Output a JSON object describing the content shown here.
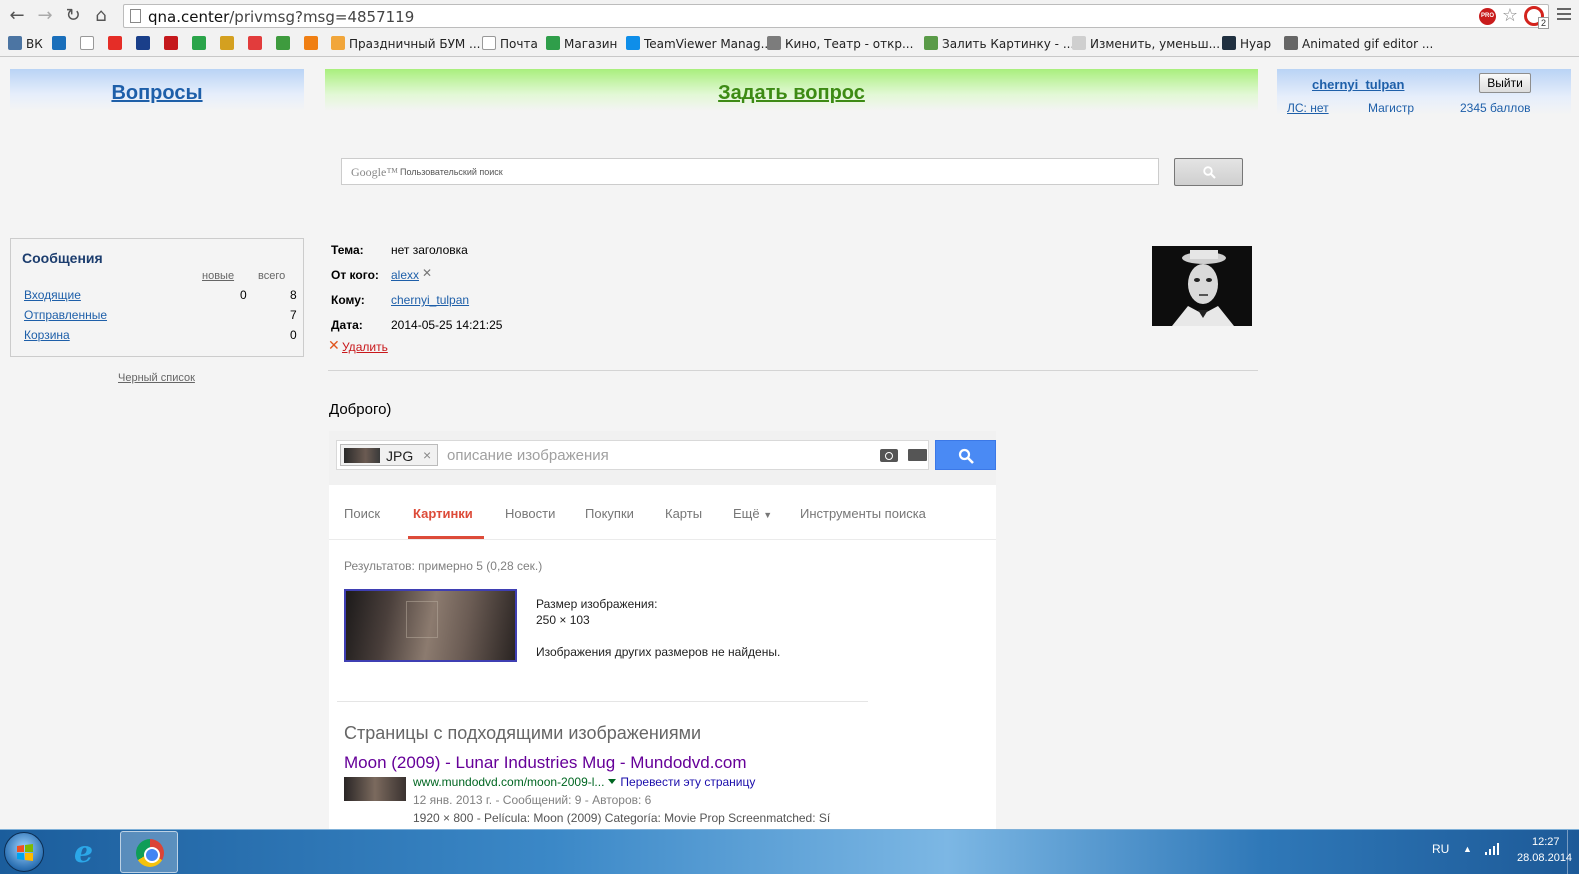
{
  "browser": {
    "url_host": "qna.center",
    "url_path": "/privmsg?msg=4857119",
    "ext_badge": "PRO",
    "opera_badge": "2",
    "bookmarks": [
      {
        "label": "ВК",
        "icon": "vk-icon",
        "color": "#4c75a3"
      },
      {
        "label": "",
        "icon": "mail-at-icon",
        "color": "#1a6fbb"
      },
      {
        "label": "",
        "icon": "yandex-icon",
        "color": "#ffffff"
      },
      {
        "label": "",
        "icon": "youtube-icon",
        "color": "#e52d27"
      },
      {
        "label": "",
        "icon": "si-icon",
        "color": "#1a3f8a"
      },
      {
        "label": "",
        "icon": "r-icon",
        "color": "#c5181c"
      },
      {
        "label": "",
        "icon": "sber-icon",
        "color": "#2aa44a"
      },
      {
        "label": "",
        "icon": "ussr-icon",
        "color": "#d4a020"
      },
      {
        "label": "",
        "icon": "stripes-icon",
        "color": "#e23c3c"
      },
      {
        "label": "",
        "icon": "bird-icon",
        "color": "#3e9b3e"
      },
      {
        "label": "",
        "icon": "orange-icon",
        "color": "#f07f13"
      },
      {
        "label": "Праздничный БУМ ...",
        "icon": "mp-icon",
        "color": "#f1a63b"
      },
      {
        "label": "Почта",
        "icon": "page-icon",
        "color": "#ffffff"
      },
      {
        "label": "Магазин",
        "icon": "chrome-store-icon",
        "color": "#2f9e4a"
      },
      {
        "label": "TeamViewer Manag...",
        "icon": "teamviewer-icon",
        "color": "#0e8ee9"
      },
      {
        "label": "Кино, Театр - откр...",
        "icon": "kino-icon",
        "color": "#7c7c7c"
      },
      {
        "label": "Залить Картинку - ...",
        "icon": "picture-icon",
        "color": "#5a9b48"
      },
      {
        "label": "Изменить, уменьш...",
        "icon": "resize-icon",
        "color": "#cfcfcf"
      },
      {
        "label": "Hyap",
        "icon": "hyap-icon",
        "color": "#203040"
      },
      {
        "label": "Animated gif editor ...",
        "icon": "gif-icon",
        "color": "#666666"
      }
    ]
  },
  "nav": {
    "questions": "Вопросы",
    "ask": "Задать вопрос"
  },
  "user": {
    "name": "chernyi_tulpan",
    "logout": "Выйти",
    "pm": "ЛС: нет",
    "rank": "Магистр",
    "points": "2345 баллов"
  },
  "search": {
    "brand": "Google™",
    "placeholder": "Пользовательский поиск"
  },
  "messages_panel": {
    "title": "Сообщения",
    "col_new": "новые",
    "col_total": "всего",
    "rows": [
      {
        "label": "Входящие",
        "new": "0",
        "total": "8"
      },
      {
        "label": "Отправленные",
        "new": "",
        "total": "7"
      },
      {
        "label": "Корзина",
        "new": "",
        "total": "0"
      }
    ],
    "blacklist": "Черный список"
  },
  "message": {
    "subject_label": "Тема:",
    "subject": "нет заголовка",
    "from_label": "От кого:",
    "from": "alexx",
    "from_remove": "✕",
    "to_label": "Кому:",
    "to": "chernyi_tulpan",
    "date_label": "Дата:",
    "date": "2014-05-25 14:21:25",
    "delete_mark": "✕",
    "delete": "Удалить",
    "body": "Доброго)"
  },
  "google": {
    "chip_label": "JPG",
    "chip_close": "×",
    "query_placeholder": "описание изображения",
    "tabs": [
      "Поиск",
      "Картинки",
      "Новости",
      "Покупки",
      "Карты",
      "Ещё",
      "Инструменты поиска"
    ],
    "active_tab": "Картинки",
    "results_count": "Результатов: примерно 5 (0,28 сек.)",
    "size_label": "Размер изображения:",
    "size_value": "250 × 103",
    "no_other_sizes": "Изображения других размеров не найдены.",
    "pages_heading": "Страницы с подходящими изображениями",
    "result": {
      "title": "Moon (2009) - Lunar Industries Mug - Mundodvd.com",
      "url": "www.mundodvd.com/moon-2009-l...",
      "translate": "Перевести эту страницу",
      "meta": "12 янв. 2013 г. - Сообщений: 9 - Авторов: 6",
      "snippet": "1920 × 800 - Película: Moon (2009) Categoría: Movie Prop Screenmatched: Sí"
    }
  },
  "taskbar": {
    "lang": "RU",
    "time": "12:27",
    "date": "28.08.2014"
  },
  "colors": {
    "link_blue": "#1e5fa9",
    "ask_green": "#3d8b14",
    "google_red": "#dd4b39",
    "google_blue": "#4a8af4"
  }
}
